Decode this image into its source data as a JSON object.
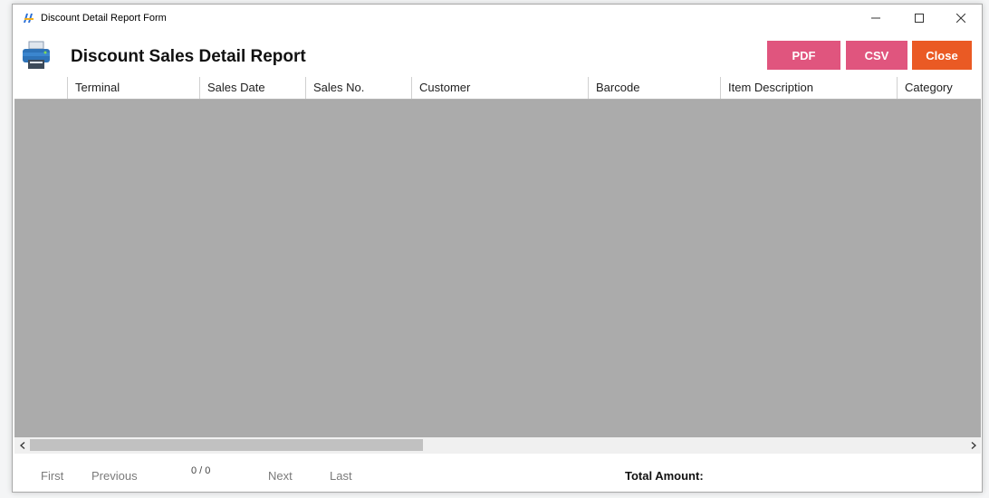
{
  "window": {
    "title": "Discount Detail Report Form",
    "controls": [
      "—",
      "☐",
      "✕"
    ]
  },
  "toolbar": {
    "title": "Discount Sales Detail Report",
    "pdf_label": "PDF",
    "csv_label": "CSV",
    "close_label": "Close"
  },
  "grid": {
    "columns": [
      "",
      "Terminal",
      "Sales Date",
      "Sales No.",
      "Customer",
      "Barcode",
      "Item Description",
      "Category"
    ],
    "rows": []
  },
  "pager": {
    "first": "First",
    "previous": "Previous",
    "count": "0 / 0",
    "next": "Next",
    "last": "Last",
    "total_label": "Total Amount:"
  },
  "colors": {
    "pdf_button": "#e0557e",
    "csv_button": "#e0557e",
    "close_button": "#ea5a24",
    "grid_background": "#ababab"
  },
  "icons": [
    "app-icon",
    "printer-icon",
    "minimize-icon",
    "maximize-icon",
    "close-icon",
    "chevron-left-icon",
    "chevron-right-icon"
  ]
}
